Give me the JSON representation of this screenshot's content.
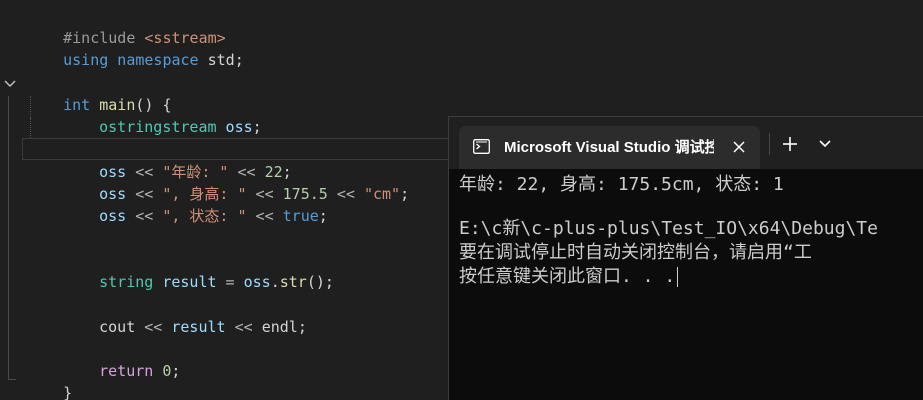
{
  "editor": {
    "lines": {
      "l1": {
        "hash": "#include ",
        "header": "<sstream>"
      },
      "l2": {
        "kw": "using",
        "kw2": " namespace",
        "ns": " std",
        "semi": ";"
      },
      "l4": {
        "type": "int",
        "fn": " main",
        "rest": "() {"
      },
      "l5": {
        "type": "ostringstream",
        "var": " oss",
        "semi": ";"
      },
      "l7": {
        "var": "oss",
        "op": " << ",
        "str": "\"年龄: \"",
        "op2": " << ",
        "num": "22",
        "semi": ";"
      },
      "l8": {
        "var": "oss",
        "op": " << ",
        "str": "\", 身高: \"",
        "op2": " << ",
        "num": "175.5",
        "op3": " << ",
        "str2": "\"cm\"",
        "semi": ";"
      },
      "l9": {
        "var": "oss",
        "op": " << ",
        "str": "\", 状态: \"",
        "op2": " << ",
        "kw": "true",
        "semi": ";"
      },
      "l12": {
        "type": "string",
        "var": " result",
        "op": " = ",
        "var2": "oss",
        "dot": ".",
        "fn": "str",
        "rest": "();"
      },
      "l14": {
        "plain": "cout",
        "op": " << ",
        "var": "result",
        "op2": " << ",
        "plain2": "endl",
        "semi": ";"
      },
      "l16": {
        "kw": "return",
        "num": " 0",
        "semi": ";"
      },
      "l17": {
        "brace": "}"
      }
    }
  },
  "terminal": {
    "tab_title": "Microsoft Visual Studio 调试控",
    "tab_icon": "terminal-app-icon",
    "output": [
      "年龄: 22, 身高: 175.5cm, 状态: 1",
      "E:\\c新\\c-plus-plus\\Test_IO\\x64\\Debug\\Te",
      "要在调试停止时自动关闭控制台，请启用“工",
      "按任意键关闭此窗口. . ."
    ]
  }
}
